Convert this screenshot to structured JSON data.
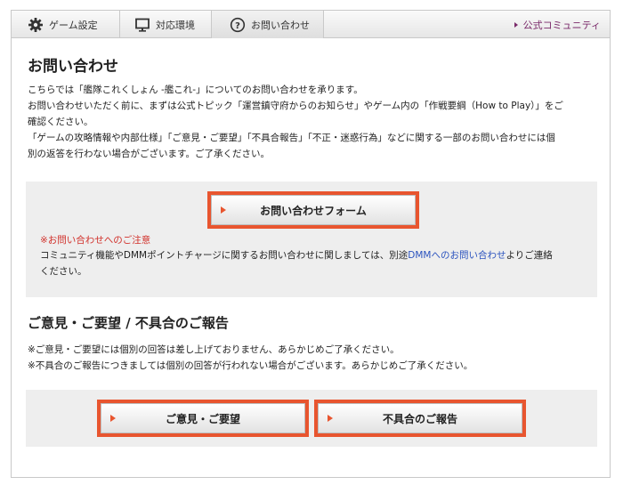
{
  "tabs": {
    "game_settings": "ゲーム設定",
    "environment": "対応環境",
    "contact": "お問い合わせ"
  },
  "community_link": "公式コミュニティ",
  "contact_section": {
    "title": "お問い合わせ",
    "lines": [
      "こちらでは「艦隊これくしょん -艦これ-」についてのお問い合わせを承ります。",
      "お問い合わせいただく前に、まずは公式トピック「運営鎮守府からのお知らせ」やゲーム内の「作戦要綱（How to Play）」をご",
      "確認ください。",
      "「ゲームの攻略情報や内部仕様」「ご意見・ご要望」「不具合報告」「不正・迷惑行為」などに関する一部のお問い合わせには個",
      "別の返答を行わない場合がございます。ご了承ください。"
    ],
    "form_button": "お問い合わせフォーム",
    "note_title": "※お問い合わせへのご注意",
    "note_line1_before": "コミュニティ機能やDMMポイントチャージに関するお問い合わせに関しましては、別途",
    "note_link": "DMMへのお問い合わせ",
    "note_line1_after": "よりご連絡",
    "note_line2": "ください。"
  },
  "feedback_section": {
    "title": "ご意見・ご要望 / 不具合のご報告",
    "lines": [
      "※ご意見・ご要望には個別の回答は差し上げておりません、あらかじめご了承ください。",
      "※不具合のご報告につきましては個別の回答が行われない場合がございます。あらかじめご了承ください。"
    ],
    "opinion_button": "ご意見・ご要望",
    "bug_button": "不具合のご報告"
  },
  "colors": {
    "accent_orange": "#e8552f",
    "community_purple": "#7a2a6a",
    "notice_red": "#d1302a",
    "link_blue": "#2a52be"
  },
  "icons": {
    "game_settings": "gear-icon",
    "environment": "monitor-icon",
    "contact": "question-circle-icon"
  }
}
